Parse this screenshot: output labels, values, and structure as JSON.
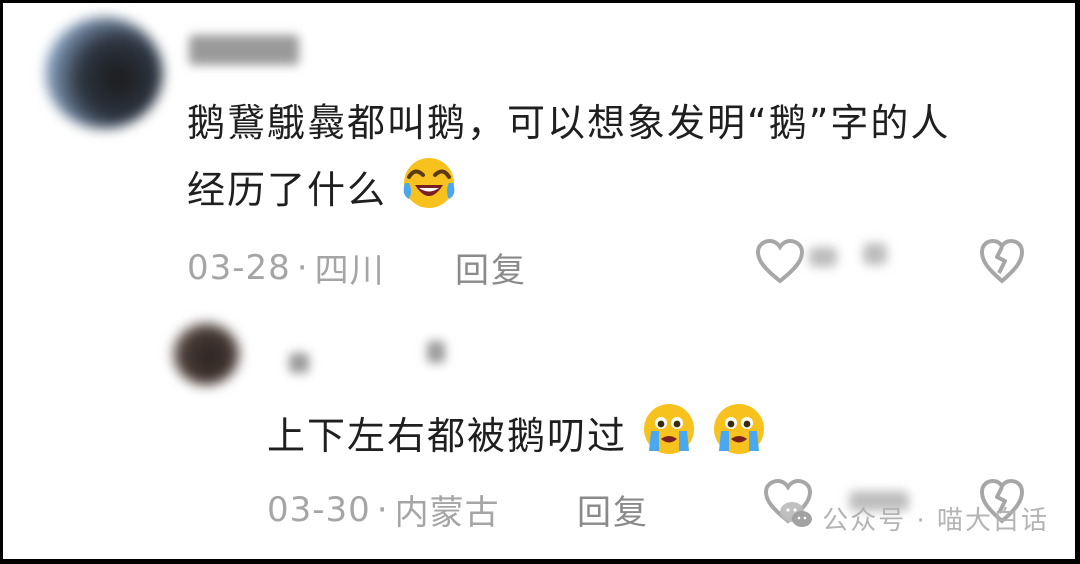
{
  "comments": [
    {
      "text_line1": "鹅鵞䳘䳗都叫鹅，可以想象发明“鹅”字的人",
      "text_line2": "经历了什么",
      "date": "03-28",
      "location": "四川",
      "reply_label": "回复"
    },
    {
      "text": "上下左右都被鹅叨过",
      "date": "03-30",
      "location": "内蒙古",
      "reply_label": "回复"
    }
  ],
  "separator": "·",
  "watermark": {
    "text": "公众号 · 喵大白话"
  },
  "icons": [
    "heart-outline-icon",
    "broken-heart-icon",
    "laughing-tears-emoji",
    "crying-emoji",
    "wechat-logo-icon"
  ]
}
